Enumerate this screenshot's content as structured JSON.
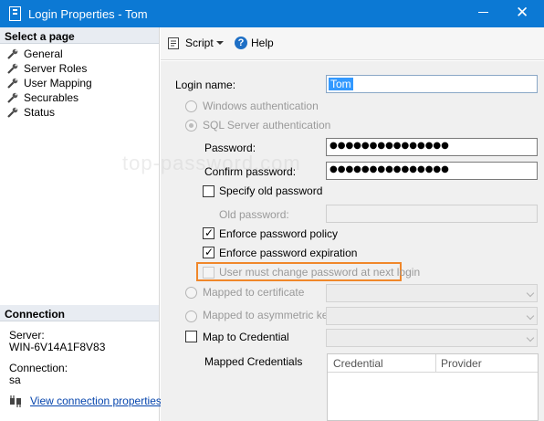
{
  "window": {
    "title": "Login Properties - Tom",
    "close_glyph": "✕"
  },
  "left_pane": {
    "select_page_heading": "Select a page",
    "pages": [
      {
        "label": "General",
        "icon": "wrench-icon"
      },
      {
        "label": "Server Roles",
        "icon": "wrench-icon"
      },
      {
        "label": "User Mapping",
        "icon": "wrench-icon"
      },
      {
        "label": "Securables",
        "icon": "wrench-icon"
      },
      {
        "label": "Status",
        "icon": "wrench-icon"
      }
    ],
    "connection_heading": "Connection",
    "server_label": "Server:",
    "server_value": "WIN-6V14A1F8V83",
    "connection_label": "Connection:",
    "connection_value": "sa",
    "view_link": "View connection properties"
  },
  "toolbar": {
    "script_label": "Script",
    "help_label": "Help"
  },
  "form": {
    "login_name_label": "Login name:",
    "login_name_value": "Tom",
    "windows_auth_label": "Windows authentication",
    "sql_auth_label": "SQL Server authentication",
    "password_label": "Password:",
    "password_mask": "●●●●●●●●●●●●●●●",
    "confirm_password_label": "Confirm password:",
    "confirm_password_mask": "●●●●●●●●●●●●●●●",
    "specify_old_label": "Specify old password",
    "old_password_label": "Old password:",
    "enforce_policy_label": "Enforce password policy",
    "enforce_expiration_label": "Enforce password expiration",
    "must_change_label": "User must change password at next login",
    "mapped_cert_label": "Mapped to certificate",
    "mapped_key_label": "Mapped to asymmetric key",
    "map_credential_label": "Map to Credential",
    "mapped_credentials_label": "Mapped Credentials",
    "grid_headers": [
      "Credential",
      "Provider"
    ]
  },
  "checkmark": "✓",
  "watermark": "top-password.com",
  "colors": {
    "titlebar": "#0c79d4",
    "highlight": "#f0872a",
    "selection": "#3399ff"
  }
}
